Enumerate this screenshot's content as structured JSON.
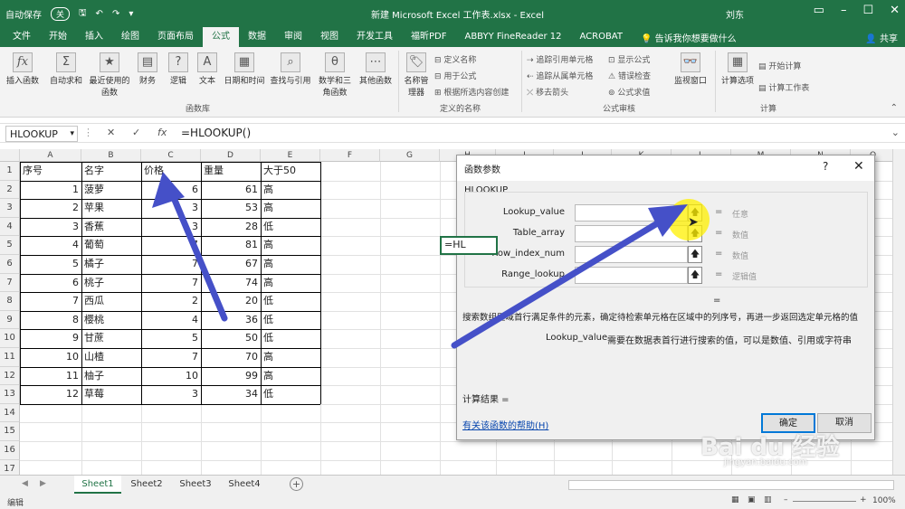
{
  "titlebar": {
    "autosave": "自动保存",
    "autosave_state": "关",
    "title": "新建 Microsoft Excel 工作表.xlsx  -  Excel",
    "user": "刘东"
  },
  "tabs": [
    "文件",
    "开始",
    "插入",
    "绘图",
    "页面布局",
    "公式",
    "数据",
    "审阅",
    "视图",
    "开发工具",
    "福昕PDF",
    "ABBYY FineReader 12",
    "ACROBAT"
  ],
  "active_tab": "公式",
  "tell_me": "告诉我你想要做什么",
  "share": "共享",
  "ribbon": {
    "insert_function": "插入函数",
    "autosum": "自动求和",
    "recent": "最近使用的函数",
    "financial": "财务",
    "logical": "逻辑",
    "text": "文本",
    "datetime": "日期和时间",
    "lookup": "查找与引用",
    "math": "数学和三角函数",
    "other": "其他函数",
    "library_group": "函数库",
    "name_manager": "名称管理器",
    "define_name": "定义名称",
    "use_in_formula": "用于公式",
    "create_from_sel": "根据所选内容创建",
    "names_group": "定义的名称",
    "trace_prec": "追踪引用单元格",
    "trace_dep": "追踪从属单元格",
    "remove_arrows": "移去箭头",
    "show_formulas": "显示公式",
    "error_check": "错误检查",
    "eval_formula": "公式求值",
    "audit_group": "公式审核",
    "watch": "监视窗口",
    "calc_options": "计算选项",
    "calc_now": "开始计算",
    "calc_sheet": "计算工作表",
    "calc_group": "计算"
  },
  "formula_bar": {
    "name_box": "HLOOKUP",
    "cancel": "✕",
    "enter": "✓",
    "fx": "fx",
    "formula": "=HLOOKUP()"
  },
  "columns": [
    "A",
    "B",
    "C",
    "D",
    "E",
    "F",
    "G",
    "H",
    "I",
    "J",
    "K",
    "L",
    "M",
    "N",
    "O",
    "P"
  ],
  "rows": [
    "1",
    "2",
    "3",
    "4",
    "5",
    "6",
    "7",
    "8",
    "9",
    "10",
    "11",
    "12",
    "13",
    "14",
    "15",
    "16",
    "17"
  ],
  "headers": [
    "序号",
    "名字",
    "价格",
    "重量",
    "大于50"
  ],
  "table": [
    [
      "1",
      "菠萝",
      "6",
      "61",
      "高"
    ],
    [
      "2",
      "苹果",
      "3",
      "53",
      "高"
    ],
    [
      "3",
      "香蕉",
      "3",
      "28",
      "低"
    ],
    [
      "4",
      "葡萄",
      "7",
      "81",
      "高"
    ],
    [
      "5",
      "橘子",
      "7",
      "67",
      "高"
    ],
    [
      "6",
      "桃子",
      "7",
      "74",
      "高"
    ],
    [
      "7",
      "西瓜",
      "2",
      "20",
      "低"
    ],
    [
      "8",
      "樱桃",
      "4",
      "36",
      "低"
    ],
    [
      "9",
      "甘蔗",
      "5",
      "50",
      "低"
    ],
    [
      "10",
      "山楂",
      "7",
      "70",
      "高"
    ],
    [
      "11",
      "柚子",
      "10",
      "99",
      "高"
    ],
    [
      "12",
      "草莓",
      "3",
      "34",
      "低"
    ]
  ],
  "edit_cell": "=HL",
  "sheets": [
    "Sheet1",
    "Sheet2",
    "Sheet3",
    "Sheet4"
  ],
  "active_sheet": "Sheet1",
  "status": {
    "mode": "编辑",
    "zoom": "100%"
  },
  "dialog": {
    "title": "函数参数",
    "help": "?",
    "close": "✕",
    "func": "HLOOKUP",
    "args": [
      {
        "label": "Lookup_value",
        "value": "任意"
      },
      {
        "label": "Table_array",
        "value": "数值"
      },
      {
        "label": "Row_index_num",
        "value": "数值"
      },
      {
        "label": "Range_lookup",
        "value": "逻辑值"
      }
    ],
    "eq": "=",
    "result_eq": "=",
    "description": "搜索数组区域首行满足条件的元素，确定待检索单元格在区域中的列序号，再进一步返回选定单元格的值",
    "arg_name": "Lookup_value",
    "arg_desc": "需要在数据表首行进行搜索的值，可以是数值、引用或字符串",
    "result": "计算结果 =",
    "help_link": "有关该函数的帮助(H)",
    "ok": "确定",
    "cancel": "取消"
  },
  "watermark": "Bai du 经验",
  "watermark_url": "jingyan.baidu.com"
}
